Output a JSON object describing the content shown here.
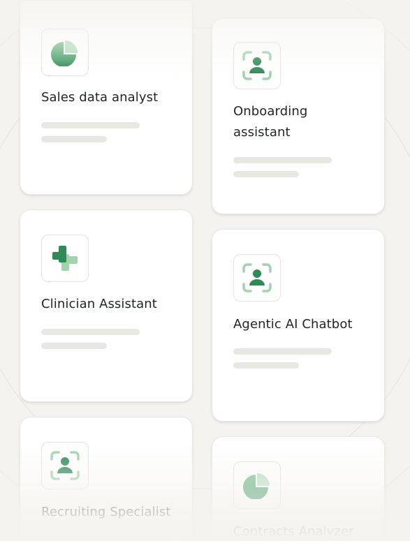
{
  "colors": {
    "background": "#f4f3ef",
    "card": "#ffffff",
    "placeholder_bar": "#e8e7e2",
    "icon_green_dark": "#2e8b57",
    "icon_green_light": "#9fd4ad"
  },
  "left_column": {
    "cards": [
      {
        "title": "Sales data analyst",
        "icon": "pie-chart-icon"
      },
      {
        "title": "Clinician Assistant",
        "icon": "medical-cross-icon"
      },
      {
        "title": "Recruiting Specialist",
        "icon": "person-scan-icon"
      }
    ]
  },
  "right_column": {
    "cards": [
      {
        "title": "Onboarding assistant",
        "icon": "person-scan-icon"
      },
      {
        "title": "Agentic AI Chatbot",
        "icon": "person-scan-icon"
      },
      {
        "title": "Contracts Analyzer",
        "icon": "pie-chart-icon"
      }
    ]
  }
}
